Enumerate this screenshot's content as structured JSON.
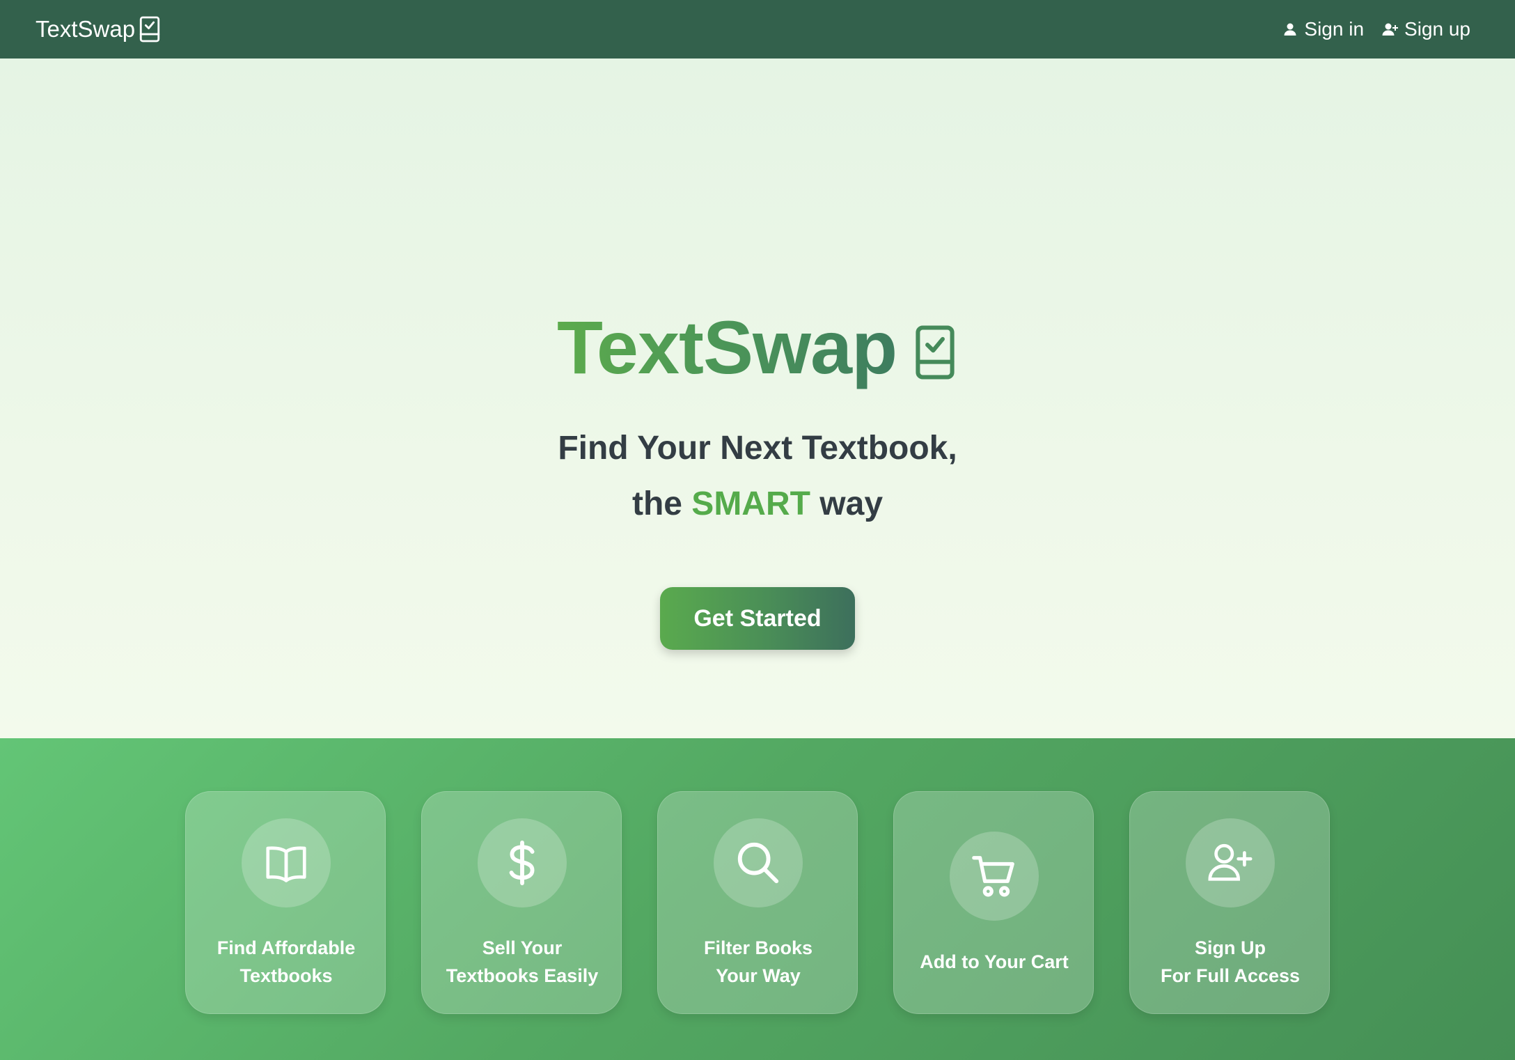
{
  "navbar": {
    "brand": "TextSwap",
    "brand_icon": "book-check-icon",
    "sign_in": "Sign in",
    "sign_in_icon": "user-icon",
    "sign_up": "Sign up",
    "sign_up_icon": "user-plus-icon"
  },
  "hero": {
    "title": "TextSwap",
    "title_icon": "book-check-icon",
    "subtitle_line1": "Find Your Next Textbook,",
    "subtitle_line2_pre": "the",
    "subtitle_line2_highlight": "SMART",
    "subtitle_line2_post": "way",
    "cta": "Get Started"
  },
  "features": [
    {
      "line1": "Find Affordable",
      "line2": "Textbooks",
      "icon": "open-book-icon"
    },
    {
      "line1": "Sell Your",
      "line2": "Textbooks Easily",
      "icon": "dollar-icon"
    },
    {
      "line1": "Filter Books",
      "line2": "Your Way",
      "icon": "search-icon"
    },
    {
      "line1": "Add to Your Cart",
      "icon": "cart-icon"
    },
    {
      "line1": "Sign Up",
      "line2": "For Full Access",
      "icon": "user-plus-icon"
    }
  ],
  "colors": {
    "navbar_bg": "#33614c",
    "accent_green": "#55ab4b",
    "heading_text": "#333d44",
    "features_bg_start": "#63c576",
    "features_bg_end": "#458f55"
  }
}
